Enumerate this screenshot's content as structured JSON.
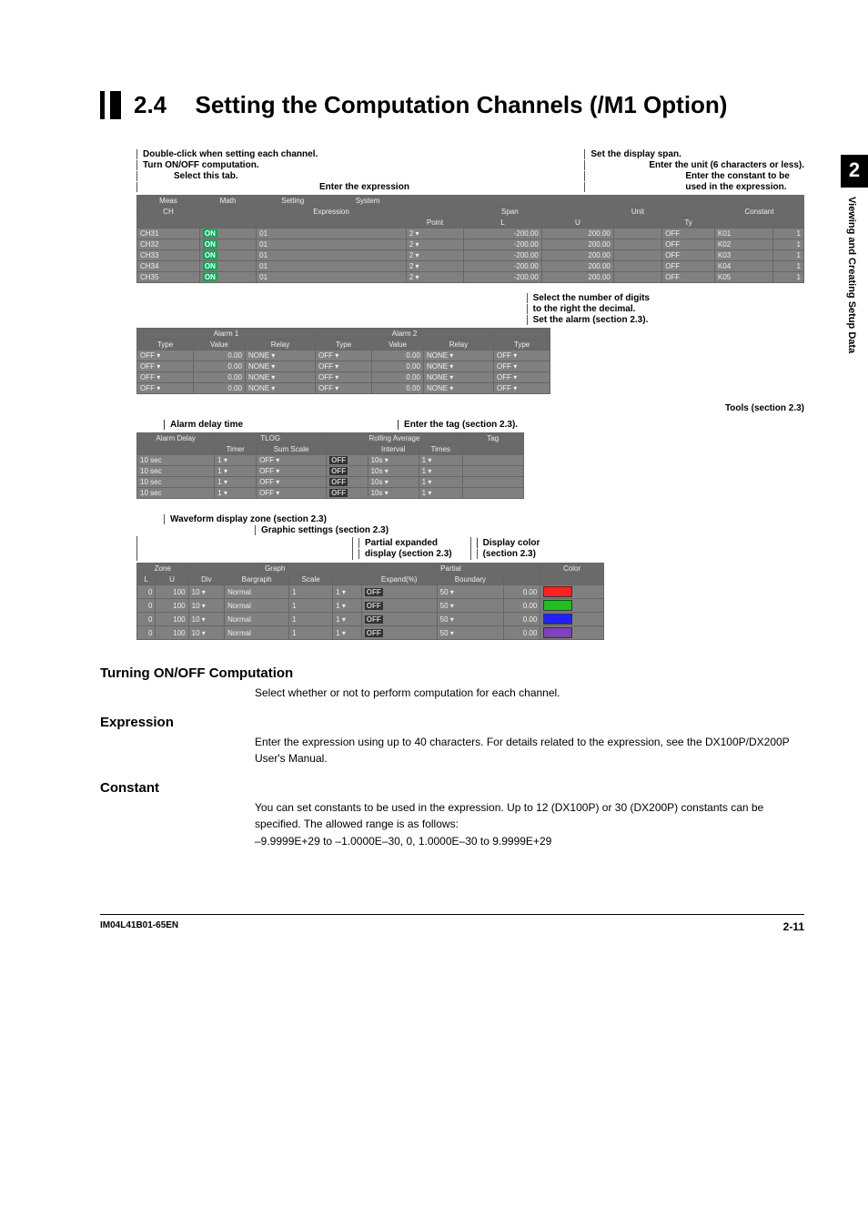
{
  "header": {
    "section_number": "2.4",
    "section_title": "Setting the Computation Channels (/M1 Option)"
  },
  "side_marker": {
    "chapter": "2",
    "text": "Viewing and Creating Setup Data"
  },
  "callouts": {
    "top_left": [
      "Double-click when setting each channel.",
      "Turn ON/OFF computation.",
      "Select this tab."
    ],
    "top_center": "Enter the expression",
    "top_right_head": "Set the display span.",
    "top_right": [
      "Enter the unit (6 characters or less).",
      "Enter the constant to be",
      "used in the expression."
    ],
    "panel1": {
      "tabs": [
        "Meas",
        "Math",
        "Setting",
        "System"
      ],
      "col_expr": "Expression",
      "span_hdr": "Span",
      "span_cols": [
        "Point",
        "L",
        "U"
      ],
      "unit_hdr": "Unit",
      "ty_hdr": "Ty",
      "const_hdr": "Constant",
      "rows": [
        {
          "ch": "CH31",
          "on": "ON",
          "expr": "01",
          "pt": "2",
          "l": "-200.00",
          "u": "200.00",
          "unit": "",
          "ty": "OFF",
          "k": "K01",
          "kv": "1"
        },
        {
          "ch": "CH32",
          "on": "ON",
          "expr": "01",
          "pt": "2",
          "l": "-200.00",
          "u": "200.00",
          "unit": "",
          "ty": "OFF",
          "k": "K02",
          "kv": "1"
        },
        {
          "ch": "CH33",
          "on": "ON",
          "expr": "01",
          "pt": "2",
          "l": "-200.00",
          "u": "200.00",
          "unit": "",
          "ty": "OFF",
          "k": "K03",
          "kv": "1"
        },
        {
          "ch": "CH34",
          "on": "ON",
          "expr": "01",
          "pt": "2",
          "l": "-200.00",
          "u": "200.00",
          "unit": "",
          "ty": "OFF",
          "k": "K04",
          "kv": "1"
        },
        {
          "ch": "CH35",
          "on": "ON",
          "expr": "01",
          "pt": "2",
          "l": "-200.00",
          "u": "200.00",
          "unit": "",
          "ty": "OFF",
          "k": "K05",
          "kv": "1"
        }
      ]
    },
    "mid_right": [
      "Select the number of digits",
      "to the right the decimal.",
      "Set the alarm (section 2.3)."
    ],
    "panel2": {
      "a1": "Alarm 1",
      "a2": "Alarm 2",
      "cols": [
        "Type",
        "Value",
        "Relay",
        "Type",
        "Value",
        "Relay",
        "Type"
      ],
      "rows": [
        {
          "t1": "OFF",
          "v1": "0.00",
          "r1": "NONE",
          "t2": "OFF",
          "v2": "0.00",
          "r2": "NONE",
          "t3": "OFF"
        },
        {
          "t1": "OFF",
          "v1": "0.00",
          "r1": "NONE",
          "t2": "OFF",
          "v2": "0.00",
          "r2": "NONE",
          "t3": "OFF"
        },
        {
          "t1": "OFF",
          "v1": "0.00",
          "r1": "NONE",
          "t2": "OFF",
          "v2": "0.00",
          "r2": "NONE",
          "t3": "OFF"
        },
        {
          "t1": "OFF",
          "v1": "0.00",
          "r1": "NONE",
          "t2": "OFF",
          "v2": "0.00",
          "r2": "NONE",
          "t3": "OFF"
        }
      ]
    },
    "tools_label": "Tools (section 2.3)",
    "panel3_left_label": "Alarm delay time",
    "panel3_right_label": "Enter the tag (section 2.3).",
    "panel3": {
      "hdr1": "Alarm Delay",
      "hdr2": "TLOG",
      "hdr3": "Rolling Average",
      "hdr4": "Tag",
      "cols": [
        "",
        "Timer",
        "Sum Scale",
        "",
        "Interval",
        "Times"
      ],
      "rows": [
        {
          "d": "10 sec",
          "t": "1",
          "ss": "OFF",
          "ra": "OFF",
          "iv": "10s",
          "tm": "1"
        },
        {
          "d": "10 sec",
          "t": "1",
          "ss": "OFF",
          "ra": "OFF",
          "iv": "10s",
          "tm": "1"
        },
        {
          "d": "10 sec",
          "t": "1",
          "ss": "OFF",
          "ra": "OFF",
          "iv": "10s",
          "tm": "1"
        },
        {
          "d": "10 sec",
          "t": "1",
          "ss": "OFF",
          "ra": "OFF",
          "iv": "10s",
          "tm": "1"
        }
      ]
    },
    "panel4_labels": {
      "zone": "Waveform display zone (section 2.3)",
      "graphic": "Graphic settings (section 2.3)",
      "partial": "Partial expanded",
      "partial2": "display (section 2.3)",
      "color": "Display color",
      "color2": "(section 2.3)"
    },
    "panel4": {
      "hdr_zone": "Zone",
      "hdr_graph": "Graph",
      "hdr_partial": "Partial",
      "hdr_color": "Color",
      "cols": [
        "L",
        "U",
        "Div",
        "Bargraph",
        "Scale",
        "",
        "Expand(%)",
        "Boundary"
      ],
      "rows": [
        {
          "l": "0",
          "u": "100",
          "div": "10",
          "bg": "Normal",
          "sc": "1",
          "p": "1",
          "off": "OFF",
          "ex": "50",
          "bd": "0.00",
          "color": "#ff2020"
        },
        {
          "l": "0",
          "u": "100",
          "div": "10",
          "bg": "Normal",
          "sc": "1",
          "p": "1",
          "off": "OFF",
          "ex": "50",
          "bd": "0.00",
          "color": "#20c020"
        },
        {
          "l": "0",
          "u": "100",
          "div": "10",
          "bg": "Normal",
          "sc": "1",
          "p": "1",
          "off": "OFF",
          "ex": "50",
          "bd": "0.00",
          "color": "#2020ff"
        },
        {
          "l": "0",
          "u": "100",
          "div": "10",
          "bg": "Normal",
          "sc": "1",
          "p": "1",
          "off": "OFF",
          "ex": "50",
          "bd": "0.00",
          "color": "#8040c0"
        }
      ]
    }
  },
  "body": {
    "s1_title": "Turning ON/OFF Computation",
    "s1_text": "Select whether or not to perform computation for each channel.",
    "s2_title": "Expression",
    "s2_text": "Enter the expression using up to 40 characters. For details related to the expression, see the DX100P/DX200P User's Manual.",
    "s3_title": "Constant",
    "s3_text1": "You can set constants to be used in the expression. Up to 12 (DX100P) or 30 (DX200P) constants can be specified. The allowed range is as follows:",
    "s3_text2": "–9.9999E+29 to –1.0000E–30, 0, 1.0000E–30 to 9.9999E+29"
  },
  "footer": {
    "doc_id": "IM04L41B01-65EN",
    "page": "2-11"
  }
}
